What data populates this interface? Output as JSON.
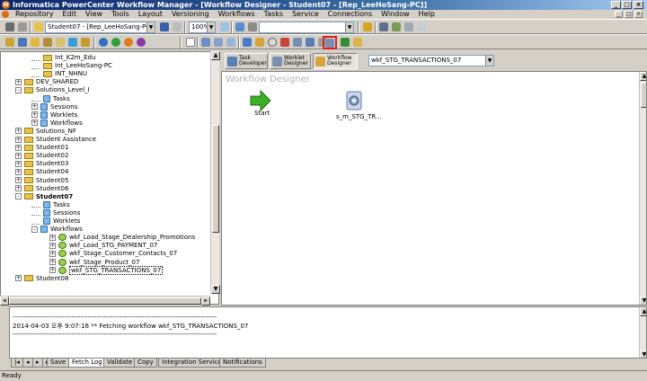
{
  "window": {
    "title": "Informatica PowerCenter Workflow Manager - [Workflow Designer - Student07 - [Rep_LeeHoSang-PC]]",
    "app_icon": "W",
    "buttons": [
      "_",
      "□",
      "×"
    ]
  },
  "menu": [
    "Repository",
    "Edit",
    "View",
    "Tools",
    "Layout",
    "Versioning",
    "Workflows",
    "Tasks",
    "Service",
    "Connections",
    "Window",
    "Help"
  ],
  "mdi_buttons": [
    "_",
    "□",
    "×"
  ],
  "toolbar": {
    "folder_combo": "Student07 - [Rep_LeeHoSang-PC]",
    "zoom_combo": "100%",
    "blank_combo": ""
  },
  "navigator": {
    "items": [
      {
        "label": "Int_K2m_Edu",
        "depth": 2,
        "icon": "folder",
        "pm": "",
        "bold": false
      },
      {
        "label": "Int_LeeHoSang-PC",
        "depth": 2,
        "icon": "folder",
        "pm": "",
        "bold": false
      },
      {
        "label": "INT_NHNU",
        "depth": 2,
        "icon": "folder",
        "pm": "",
        "bold": false
      },
      {
        "label": "DEV_SHARED",
        "depth": 1,
        "icon": "folder",
        "pm": "+",
        "bold": false
      },
      {
        "label": "Solutions_Level_I",
        "depth": 1,
        "icon": "folder",
        "pm": "-",
        "bold": false
      },
      {
        "label": "Tasks",
        "depth": 2,
        "icon": "file",
        "pm": "",
        "bold": false
      },
      {
        "label": "Sessions",
        "depth": 2,
        "icon": "file",
        "pm": "+",
        "bold": false
      },
      {
        "label": "Worklets",
        "depth": 2,
        "icon": "file",
        "pm": "+",
        "bold": false
      },
      {
        "label": "Workflows",
        "depth": 2,
        "icon": "file",
        "pm": "+",
        "bold": false
      },
      {
        "label": "Solutions_NF",
        "depth": 1,
        "icon": "folder",
        "pm": "+",
        "bold": false
      },
      {
        "label": "Student Assistance",
        "depth": 1,
        "icon": "folder",
        "pm": "+",
        "bold": false
      },
      {
        "label": "Student01",
        "depth": 1,
        "icon": "folder",
        "pm": "+",
        "bold": false
      },
      {
        "label": "Student02",
        "depth": 1,
        "icon": "folder",
        "pm": "+",
        "bold": false
      },
      {
        "label": "Student03",
        "depth": 1,
        "icon": "folder",
        "pm": "+",
        "bold": false
      },
      {
        "label": "Student04",
        "depth": 1,
        "icon": "folder",
        "pm": "+",
        "bold": false
      },
      {
        "label": "Student05",
        "depth": 1,
        "icon": "folder",
        "pm": "+",
        "bold": false
      },
      {
        "label": "Student06",
        "depth": 1,
        "icon": "folder",
        "pm": "+",
        "bold": false
      },
      {
        "label": "Student07",
        "depth": 1,
        "icon": "folder",
        "pm": "-",
        "bold": true
      },
      {
        "label": "Tasks",
        "depth": 2,
        "icon": "file",
        "pm": "",
        "bold": false
      },
      {
        "label": "Sessions",
        "depth": 2,
        "icon": "file",
        "pm": "",
        "bold": false
      },
      {
        "label": "Worklets",
        "depth": 2,
        "icon": "file",
        "pm": "",
        "bold": false
      },
      {
        "label": "Workflows",
        "depth": 2,
        "icon": "file",
        "pm": "-",
        "bold": false
      },
      {
        "label": "wkf_Load_Stage_Dealership_Promotions",
        "depth": 3,
        "icon": "wf",
        "pm": "+",
        "bold": false
      },
      {
        "label": "wkf_Load_STG_PAYMENT_07",
        "depth": 3,
        "icon": "wf",
        "pm": "+",
        "bold": false
      },
      {
        "label": "wkf_Stage_Customer_Contacts_07",
        "depth": 3,
        "icon": "wf",
        "pm": "+",
        "bold": false
      },
      {
        "label": "wkf_Stage_Product_07",
        "depth": 3,
        "icon": "wf",
        "pm": "+",
        "bold": false
      },
      {
        "label": "wkf_STG_TRANSACTIONS_07",
        "depth": 3,
        "icon": "wf",
        "pm": "+",
        "bold": false,
        "selected": true
      },
      {
        "label": "Student08",
        "depth": 1,
        "icon": "folder",
        "pm": "+",
        "bold": false
      }
    ]
  },
  "tool_tabs": [
    {
      "label": "Task Developer"
    },
    {
      "label": "Worklet Designer"
    },
    {
      "label": "Workflow Designer",
      "active": true
    }
  ],
  "workflow_combo": "wkf_STG_TRANSACTIONS_07",
  "workspace": {
    "title": "Workflow Designer",
    "start_label": "Start",
    "session_label": "s_m_STG_TR..."
  },
  "output": {
    "lines": [
      "------------------------------------------------------------------------------------------",
      "2014-04-03 오후 9:07:16 ** Fetching workflow wkf_STG_TRANSACTIONS_07",
      "------------------------------------------------------------------------------------------"
    ],
    "tabs": [
      "Save",
      "Fetch Log",
      "Validate",
      "Copy",
      "Integration Service",
      "Notifications"
    ],
    "nav_buttons": [
      "|◂",
      "◂",
      "▸",
      "▸|"
    ]
  },
  "status": "Ready",
  "colors": {
    "title_start": "#0a246a",
    "title_end": "#a6caf0",
    "face": "#d4d0c8",
    "highlight_red": "#e0201a",
    "start_green": "#3fae2a"
  }
}
